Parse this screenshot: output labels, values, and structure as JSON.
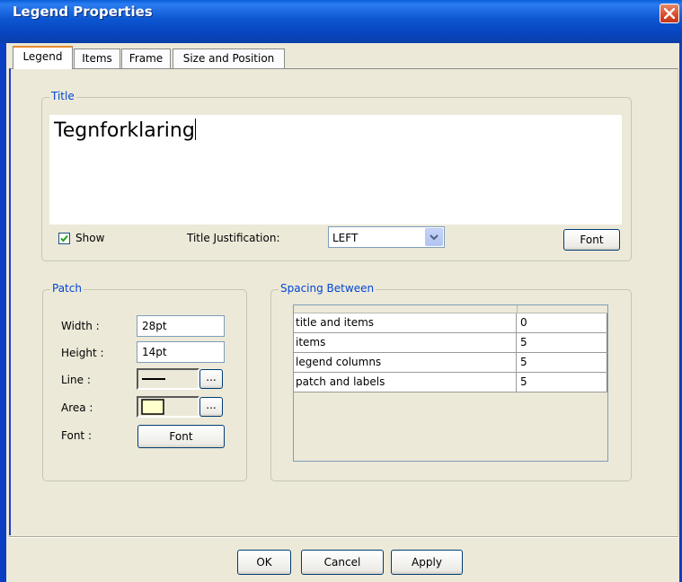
{
  "window": {
    "title": "Legend Properties",
    "close_icon": "close-icon"
  },
  "tabs": [
    {
      "label": "Legend",
      "active": true
    },
    {
      "label": "Items",
      "active": false
    },
    {
      "label": "Frame",
      "active": false
    },
    {
      "label": "Size and Position",
      "active": false
    }
  ],
  "title_group": {
    "label": "Title",
    "text": "Tegnforklaring",
    "show_label": "Show",
    "show_checked": true,
    "justification_label": "Title Justification:",
    "justification_value": "LEFT",
    "font_button": "Font"
  },
  "patch_group": {
    "label": "Patch",
    "width_label": "Width :",
    "width_value": "28pt",
    "height_label": "Height :",
    "height_value": "14pt",
    "line_label": "Line :",
    "area_label": "Area :",
    "area_fill_color": "#ffffcc",
    "font_label": "Font :",
    "font_button": "Font",
    "ellipsis": "..."
  },
  "spacing_group": {
    "label": "Spacing Between",
    "rows": [
      {
        "name": "title and items",
        "value": "0"
      },
      {
        "name": "items",
        "value": "5"
      },
      {
        "name": "legend columns",
        "value": "5"
      },
      {
        "name": "patch and labels",
        "value": "5"
      }
    ]
  },
  "footer": {
    "ok": "OK",
    "cancel": "Cancel",
    "apply": "Apply"
  }
}
